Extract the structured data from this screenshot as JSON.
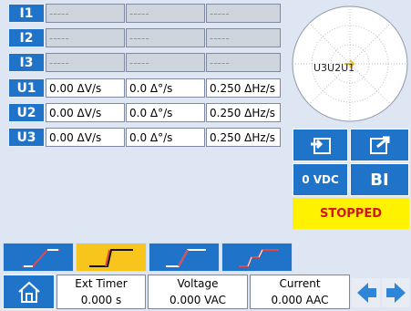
{
  "rows": [
    {
      "label": "I1",
      "c1": "-----",
      "c2": "-----",
      "c3": "-----"
    },
    {
      "label": "I2",
      "c1": "-----",
      "c2": "-----",
      "c3": "-----"
    },
    {
      "label": "I3",
      "c1": "-----",
      "c2": "-----",
      "c3": "-----"
    },
    {
      "label": "U1",
      "c1": "0.00 ΔV/s",
      "c2": "0.0 Δ°/s",
      "c3": "0.250 ΔHz/s"
    },
    {
      "label": "U2",
      "c1": "0.00 ΔV/s",
      "c2": "0.0 Δ°/s",
      "c3": "0.250 ΔHz/s"
    },
    {
      "label": "U3",
      "c1": "0.00 ΔV/s",
      "c2": "0.0 Δ°/s",
      "c3": "0.250 ΔHz/s"
    }
  ],
  "phasor": {
    "label": "U3U2U1"
  },
  "controls": {
    "vdc_label": "0 VDC",
    "bi_label": "BI",
    "status": "STOPPED"
  },
  "footer": {
    "ext_timer": {
      "title": "Ext Timer",
      "value": "0.000 s"
    },
    "voltage": {
      "title": "Voltage",
      "value": "0.000 VAC"
    },
    "current": {
      "title": "Current",
      "value": "0.000 AAC"
    }
  },
  "icons": {
    "home": "home-icon",
    "import": "import-icon",
    "export": "export-icon",
    "prev": "arrow-left-icon",
    "next": "arrow-right-icon"
  },
  "colors": {
    "accent": "#1f73c8",
    "active_tab": "#f7c51c",
    "status_bg": "#fff200",
    "status_text": "#d2141b",
    "ramp_line": "#e24a4a"
  }
}
